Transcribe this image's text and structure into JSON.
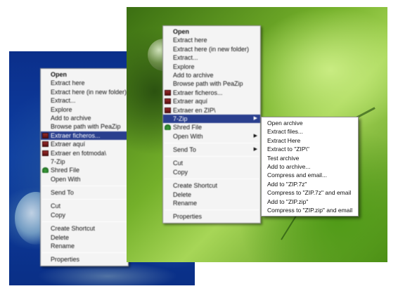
{
  "left_menu": {
    "items": [
      {
        "label": "Open",
        "bold": true
      },
      {
        "label": "Extract here"
      },
      {
        "label": "Extract here (in new folder)"
      },
      {
        "label": "Extract..."
      },
      {
        "label": "Explore"
      },
      {
        "label": "Add to archive"
      },
      {
        "label": "Browse path with PeaZip"
      },
      {
        "label": "Extraer ficheros...",
        "icon": "rar",
        "highlight": true
      },
      {
        "label": "Extraer aquí",
        "icon": "rar"
      },
      {
        "label": "Extraer en fotmoda\\",
        "icon": "rar"
      },
      {
        "label": "7-Zip"
      },
      {
        "label": "Shred File",
        "icon": "shred"
      },
      {
        "label": "Open With"
      },
      {
        "sep": true
      },
      {
        "label": "Send To"
      },
      {
        "sep": true
      },
      {
        "label": "Cut"
      },
      {
        "label": "Copy"
      },
      {
        "sep": true
      },
      {
        "label": "Create Shortcut"
      },
      {
        "label": "Delete"
      },
      {
        "label": "Rename"
      },
      {
        "sep": true
      },
      {
        "label": "Properties"
      }
    ]
  },
  "right_menu": {
    "items": [
      {
        "label": "Open",
        "bold": true
      },
      {
        "label": "Extract here"
      },
      {
        "label": "Extract here (in new folder)"
      },
      {
        "label": "Extract..."
      },
      {
        "label": "Explore"
      },
      {
        "label": "Add to archive"
      },
      {
        "label": "Browse path with PeaZip"
      },
      {
        "label": "Extraer ficheros...",
        "icon": "rar"
      },
      {
        "label": "Extraer aquí",
        "icon": "rar"
      },
      {
        "label": "Extraer en ZIP\\",
        "icon": "rar"
      },
      {
        "label": "7-Zip",
        "highlight": true,
        "arrow": true
      },
      {
        "label": "Shred File",
        "icon": "shred"
      },
      {
        "label": "Open With",
        "arrow": true
      },
      {
        "sep": true
      },
      {
        "label": "Send To",
        "arrow": true
      },
      {
        "sep": true
      },
      {
        "label": "Cut"
      },
      {
        "label": "Copy"
      },
      {
        "sep": true
      },
      {
        "label": "Create Shortcut"
      },
      {
        "label": "Delete"
      },
      {
        "label": "Rename"
      },
      {
        "sep": true
      },
      {
        "label": "Properties"
      }
    ]
  },
  "submenu_7zip": {
    "items": [
      {
        "label": "Open archive"
      },
      {
        "label": "Extract files..."
      },
      {
        "label": "Extract Here"
      },
      {
        "label": "Extract to \"ZIP\\\""
      },
      {
        "label": "Test archive"
      },
      {
        "label": "Add to archive..."
      },
      {
        "label": "Compress and email..."
      },
      {
        "label": "Add to \"ZIP.7z\""
      },
      {
        "label": "Compress to \"ZIP.7z\" and email"
      },
      {
        "label": "Add to \"ZIP.zip\""
      },
      {
        "label": "Compress to \"ZIP.zip\" and email"
      }
    ]
  },
  "arrow_glyph": "▶"
}
